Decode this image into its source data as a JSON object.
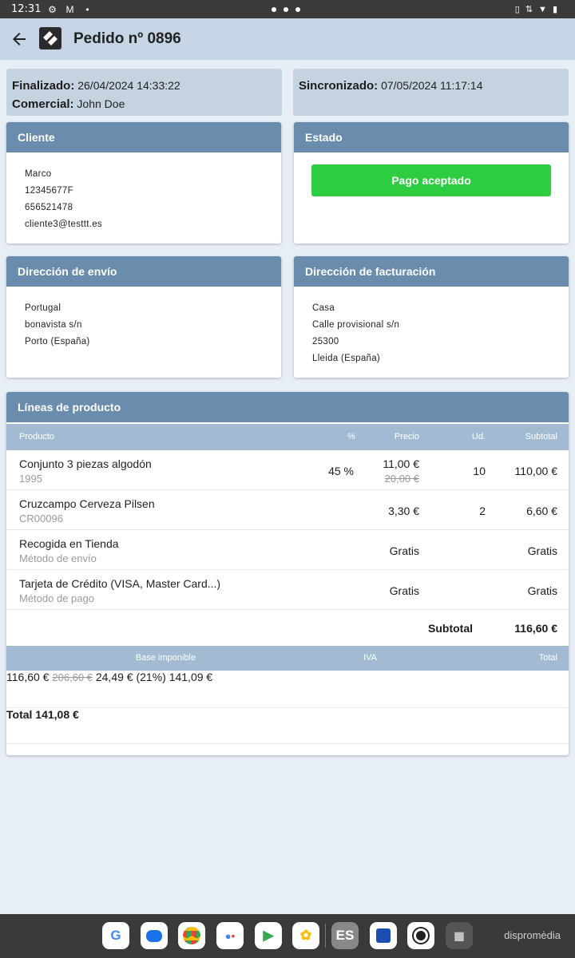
{
  "status_bar": {
    "time": "12:31"
  },
  "app_bar": {
    "title": "Pedido nº 0896"
  },
  "info": {
    "finalizado_label": "Finalizado:",
    "finalizado_value": "26/04/2024 14:33:22",
    "comercial_label": "Comercial:",
    "comercial_value": "John Doe",
    "sincronizado_label": "Sincronizado:",
    "sincronizado_value": "07/05/2024 11:17:14"
  },
  "cliente": {
    "title": "Cliente",
    "lines": [
      "Marco",
      "12345677F",
      "656521478",
      "cliente3@testtt.es"
    ]
  },
  "estado": {
    "title": "Estado",
    "status": "Pago aceptado",
    "status_color": "#2ecc40"
  },
  "envio": {
    "title": "Dirección de envío",
    "lines": [
      "Portugal",
      "bonavista s/n",
      "Porto (España)"
    ]
  },
  "facturacion": {
    "title": "Dirección de facturación",
    "lines": [
      "Casa",
      "Calle provisional s/n",
      "25300",
      "Lleida (España)"
    ]
  },
  "lineas": {
    "title": "Líneas de producto",
    "headers": {
      "producto": "Producto",
      "pct": "%",
      "precio": "Precio",
      "ud": "Ud.",
      "subtotal": "Subtotal"
    },
    "rows": [
      {
        "name": "Conjunto 3 piezas algodón",
        "sub": "1995",
        "pct": "45 %",
        "precio": "11,00 €",
        "precio_old": "20,00 €",
        "ud": "10",
        "subtotal": "110,00 €"
      },
      {
        "name": "Cruzcampo Cerveza Pilsen",
        "sub": "CR00096",
        "pct": "",
        "precio": "3,30 €",
        "precio_old": "",
        "ud": "2",
        "subtotal": "6,60 €"
      },
      {
        "name": "Recogida en Tienda",
        "sub": "Método de envío",
        "pct": "",
        "precio": "Gratis",
        "precio_old": "",
        "ud": "",
        "subtotal": "Gratis"
      },
      {
        "name": "Tarjeta de Crédito (VISA, Master Card...)",
        "sub": "Método de pago",
        "pct": "",
        "precio": "Gratis",
        "precio_old": "",
        "ud": "",
        "subtotal": "Gratis"
      }
    ],
    "subtotal_label": "Subtotal",
    "subtotal_value": "116,60 €",
    "tax_headers": {
      "base": "Base imponible",
      "iva": "IVA",
      "total": "Total"
    },
    "tax_row": {
      "base": "116,60 €",
      "base_old": "206,60 €",
      "iva": "24,49 € (21%)",
      "total": "141,09 €"
    },
    "total_label": "Total",
    "total_value": "141,08 €"
  },
  "dock": {
    "apps": [
      "google-app",
      "messages-app",
      "chrome-app",
      "assistant-app",
      "play-store-app",
      "photos-app",
      "gestion-app",
      "outlook-app",
      "camera-app",
      "app-drawer"
    ],
    "brand": "dispromèdia"
  }
}
